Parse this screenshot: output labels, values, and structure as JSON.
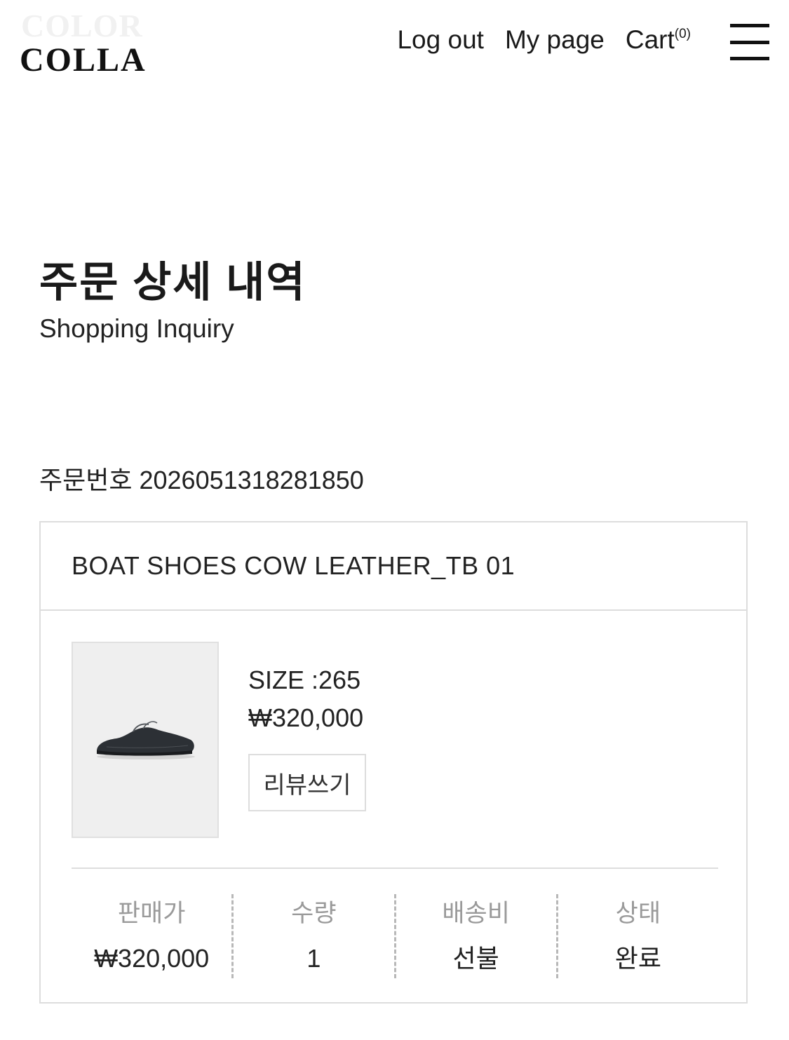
{
  "header": {
    "logo_ghost": "COLOR",
    "logo_text": "COLLA",
    "nav": {
      "logout": "Log out",
      "mypage": "My page",
      "cart_label": "Cart",
      "cart_count": "(0)"
    },
    "menu_icon": "hamburger-menu-icon"
  },
  "page": {
    "title": "주문 상세 내역",
    "subtitle": "Shopping Inquiry"
  },
  "order": {
    "number_label": "주문번호 2026051318281850",
    "product": {
      "name": "BOAT SHOES COW LEATHER_TB 01",
      "size": "SIZE :265",
      "price": "₩320,000",
      "review_button": "리뷰쓰기"
    },
    "summary": [
      {
        "label": "판매가",
        "value": "₩320,000"
      },
      {
        "label": "수량",
        "value": "1"
      },
      {
        "label": "배송비",
        "value": "선불"
      },
      {
        "label": "상태",
        "value": "완료"
      }
    ]
  }
}
